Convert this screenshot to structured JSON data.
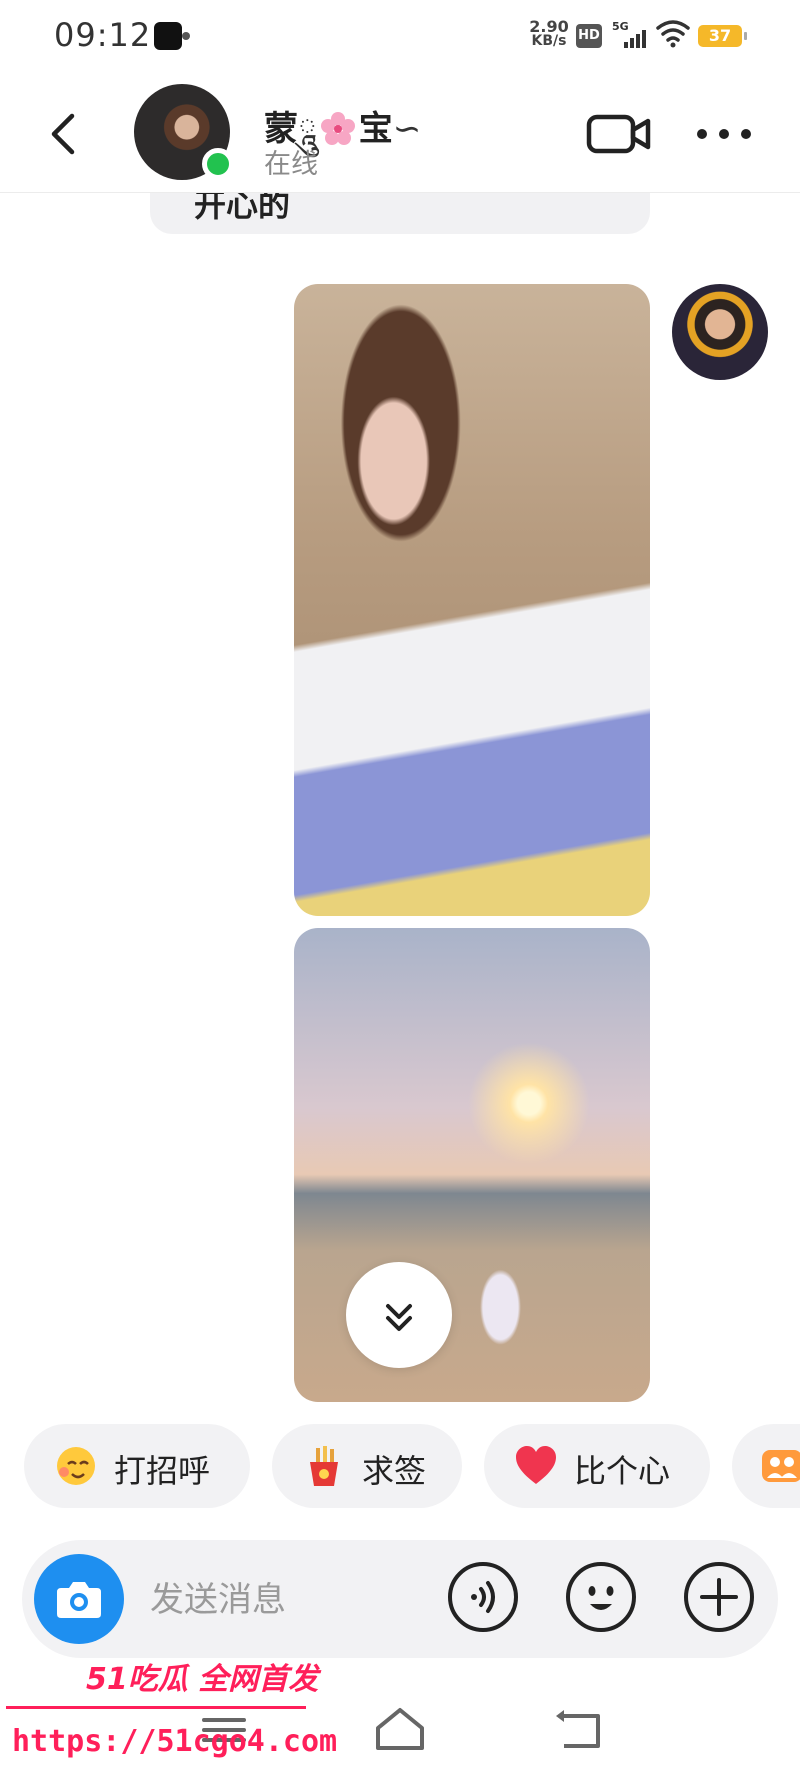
{
  "status_bar": {
    "time": "09:12",
    "net_speed_value": "2.90",
    "net_speed_unit": "KB/s",
    "hd_label": "HD",
    "signal_label": "5G",
    "battery": "37"
  },
  "header": {
    "contact_name": "蒙",
    "contact_name_part2": "宝",
    "status": "在线"
  },
  "chat": {
    "previous_message": "开心的"
  },
  "quick_replies": [
    {
      "label": "打招呼",
      "icon": "smiling-emoji-icon"
    },
    {
      "label": "求签",
      "icon": "fortune-sticks-icon"
    },
    {
      "label": "比个心",
      "icon": "heart-icon"
    },
    {
      "label": "",
      "icon": "group-photo-icon"
    }
  ],
  "input": {
    "placeholder": "发送消息"
  },
  "watermark": {
    "brand": "51吃瓜 全网首发",
    "url": "https://51cgo4.com"
  },
  "colors": {
    "online": "#22c24f",
    "camera_button": "#1e8ff0",
    "battery": "#f5b829",
    "watermark": "#ff1f5a"
  }
}
